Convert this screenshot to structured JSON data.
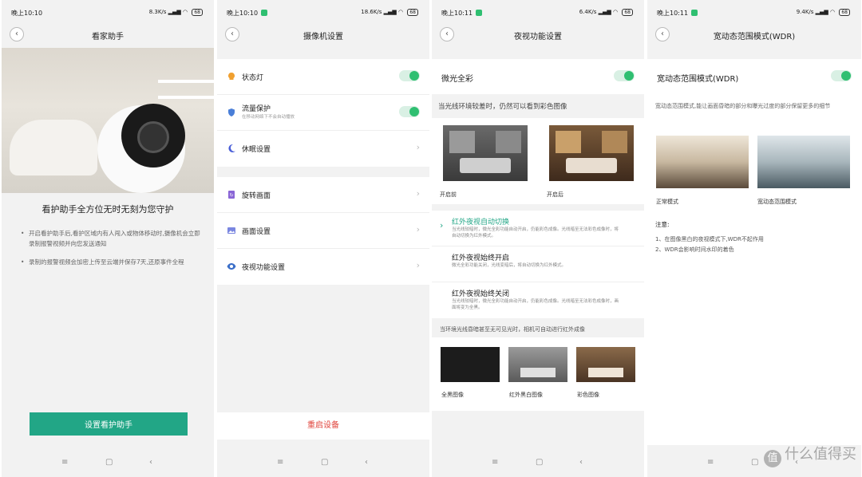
{
  "screens": [
    {
      "status": {
        "time": "晚上10:10",
        "speed": "8.3K/s",
        "battery": "68"
      },
      "title": "看家助手",
      "headline": "看护助手全方位无时无刻为您守护",
      "bullets": [
        "开启看护助手后,看护区域内有人闯入或物体移动时,摄像机会立即录制报警视频并向您发送通知",
        "录制的报警视频会加密上传至云端并保存7天,还原事件全程"
      ],
      "button": "设置看护助手"
    },
    {
      "status": {
        "time": "晚上10:10",
        "speed": "18.6K/s",
        "battery": "68"
      },
      "title": "摄像机设置",
      "group1": [
        {
          "label": "状态灯",
          "icon": "bulb-icon",
          "toggle": true
        },
        {
          "label": "流量保护",
          "sub": "在移动网络下不会自动播放",
          "icon": "shield-icon",
          "toggle": true
        },
        {
          "label": "休眠设置",
          "icon": "moon-icon",
          "toggle": false
        }
      ],
      "group2": [
        {
          "label": "旋转画面",
          "icon": "rotate-icon"
        },
        {
          "label": "画面设置",
          "icon": "image-icon"
        },
        {
          "label": "夜视功能设置",
          "icon": "eye-icon"
        }
      ],
      "restart": "重启设备"
    },
    {
      "status": {
        "time": "晚上10:11",
        "speed": "6.4K/s",
        "battery": "68"
      },
      "title": "夜视功能设置",
      "toggle_label": "微光全彩",
      "desc": "当光线环境较差时，仍然可以看到彩色图像",
      "before_label": "开启前",
      "after_label": "开启后",
      "options": [
        {
          "title": "红外夜视自动切换",
          "desc": "当光线较暗时，微光全彩功能自动开启，仍能彩色成像。光线暗至无法彩色成像时，将自动切换为红外模式。",
          "selected": true
        },
        {
          "title": "红外夜视始终开启",
          "desc": "微光全彩功能关闭，光线变暗后，将自动切换为红外模式。",
          "selected": false
        },
        {
          "title": "红外夜视始终关闭",
          "desc": "当光线较暗时，微光全彩功能自动开启，仍能彩色成像。光线暗至无法彩色成像时，画面将变为全黑。",
          "selected": false
        }
      ],
      "desc2": "当环境光线昏暗甚至无可见光时，相机可自动进行红外成像",
      "thumbs": [
        "全黑图像",
        "红外黑白图像",
        "彩色图像"
      ]
    },
    {
      "status": {
        "time": "晚上10:11",
        "speed": "9.4K/s",
        "battery": "68"
      },
      "title": "宽动态范围模式(WDR)",
      "toggle_label": "宽动态范围模式(WDR)",
      "desc": "宽动态范围模式,能让画面昏暗的部分和曝光过度的部分保留更多的细节",
      "normal_label": "正常模式",
      "wdr_label": "宽动态范围模式",
      "note_title": "注意:",
      "notes": [
        "1、在图像黑白的夜视模式下,WDR不起作用",
        "2、WDR会影响时间水印的着色"
      ]
    }
  ],
  "watermark": {
    "badge": "值",
    "text": "什么值得买"
  },
  "colors": {
    "accent": "#22a686",
    "toggle_on": "#2fbf71",
    "danger": "#e0433b"
  }
}
